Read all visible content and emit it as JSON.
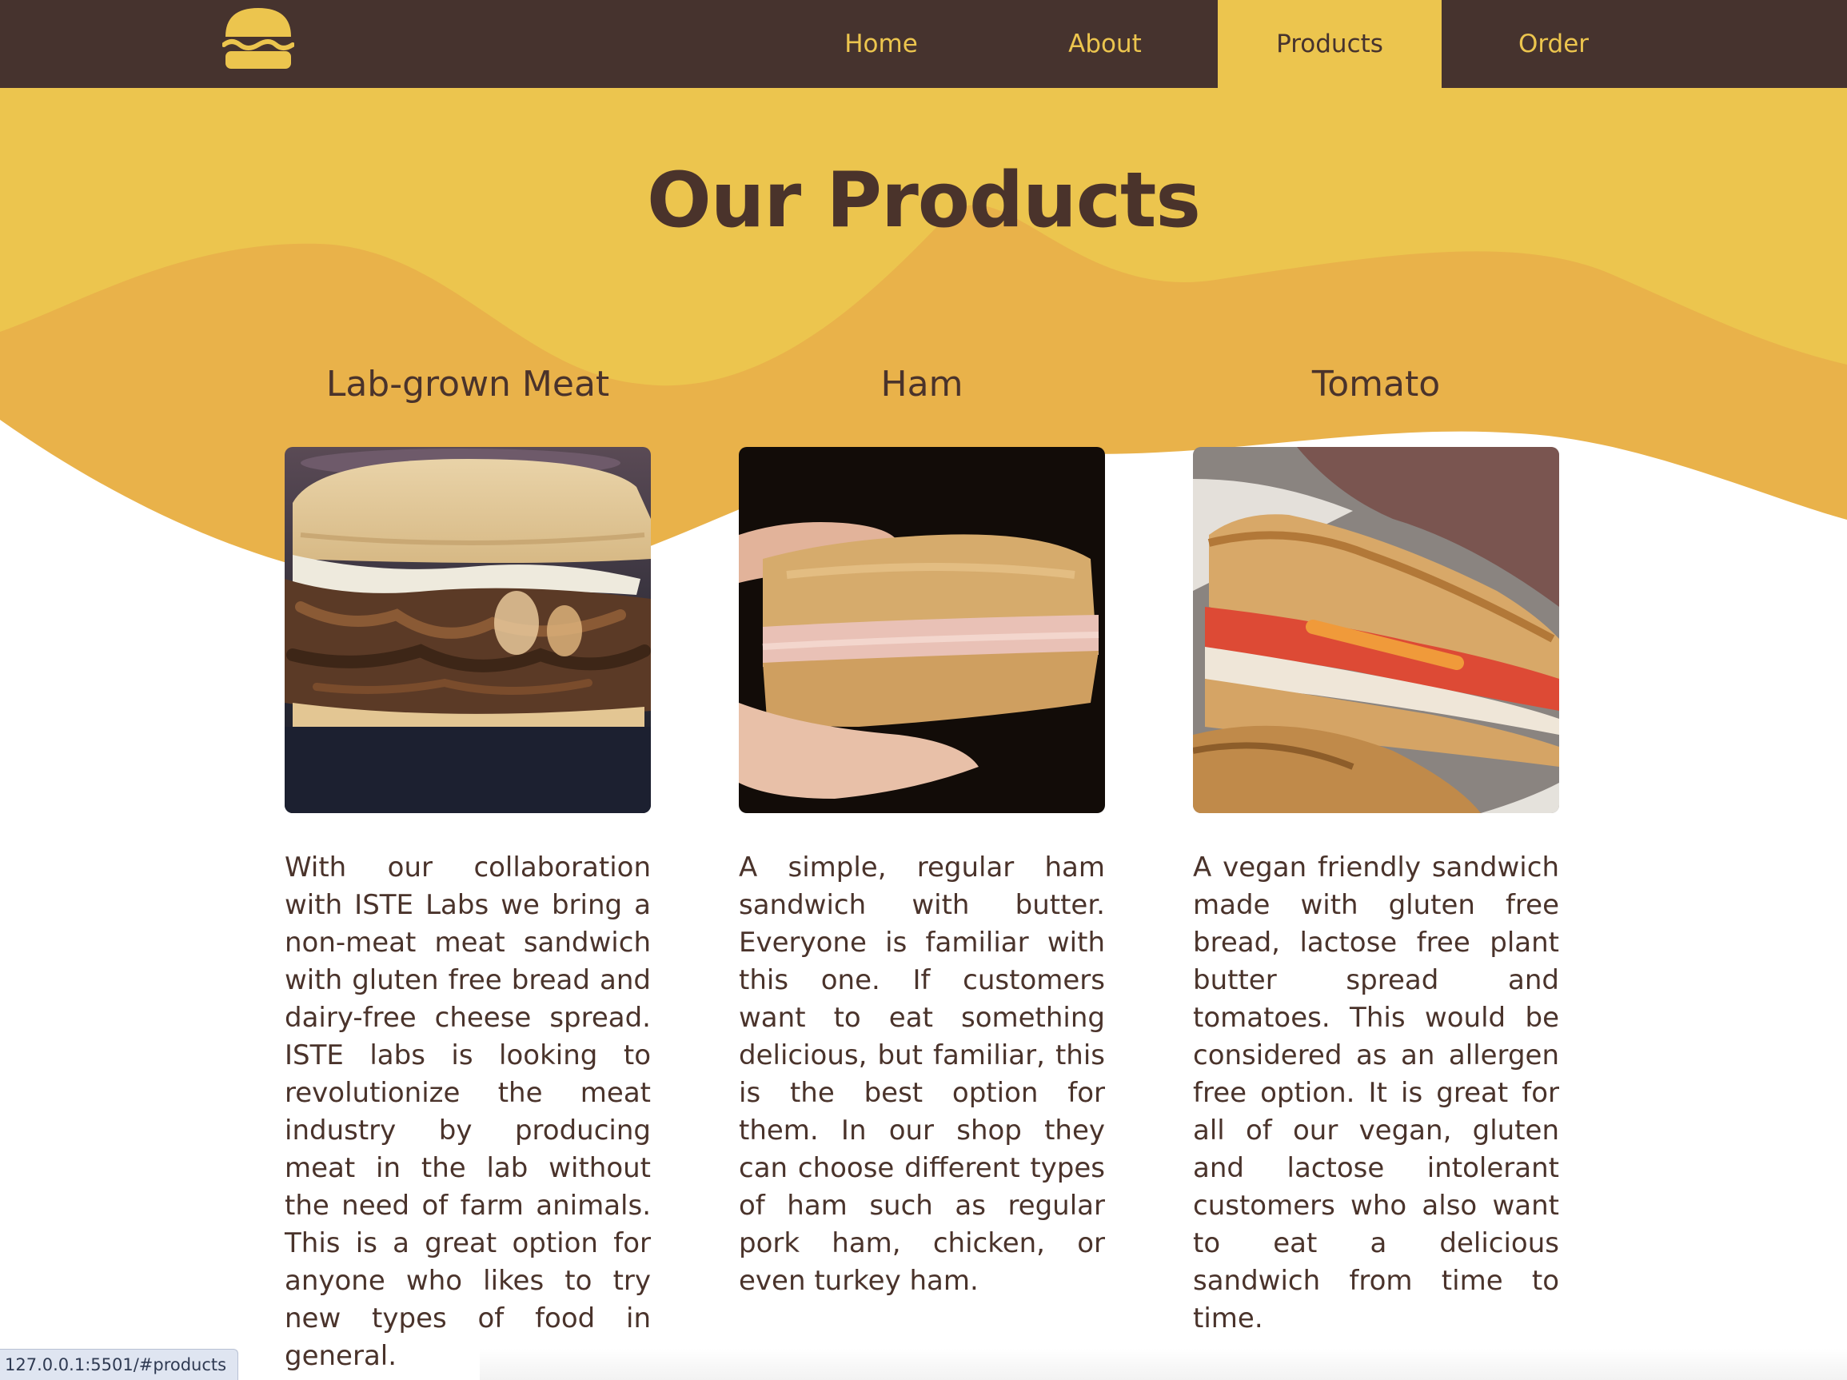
{
  "nav": {
    "logo_icon": "burger-icon",
    "links": [
      {
        "label": "Home",
        "active": false
      },
      {
        "label": "About",
        "active": false
      },
      {
        "label": "Products",
        "active": true
      },
      {
        "label": "Order",
        "active": false
      }
    ]
  },
  "page": {
    "title": "Our Products"
  },
  "products": [
    {
      "name": "Lab-grown Meat",
      "image": "lab-grown-meat-sandwich-photo",
      "description": "With our collaboration with ISTE Labs we bring a non-meat meat sandwich with gluten free bread and dairy-free cheese spread. ISTE labs is looking to revolutionize the meat industry by producing meat in the lab without the need of farm animals. This is a great option for anyone who likes to try new types of food in general."
    },
    {
      "name": "Ham",
      "image": "ham-sandwich-photo",
      "description": "A simple, regular ham sandwich with butter. Everyone is familiar with this one. If customers want to eat something delicious, but familiar, this is the best option for them. In our shop they can choose different types of ham such as regular pork ham, chicken, or even turkey ham."
    },
    {
      "name": "Tomato",
      "image": "tomato-sandwich-photo",
      "description": "A vegan friendly sandwich made with gluten free bread, lactose free plant butter spread and tomatoes. This would be considered as an allergen free option. It is great for all of our vegan, gluten and lactose intolerant customers who also want to eat a delicious sandwich from time to time."
    }
  ],
  "status_bar": {
    "url": "127.0.0.1:5501/#products"
  },
  "colors": {
    "nav_bg": "#46332e",
    "accent_yellow": "#ecc54e",
    "wave_orange": "#e9b24a",
    "text_brown": "#4a332b"
  }
}
